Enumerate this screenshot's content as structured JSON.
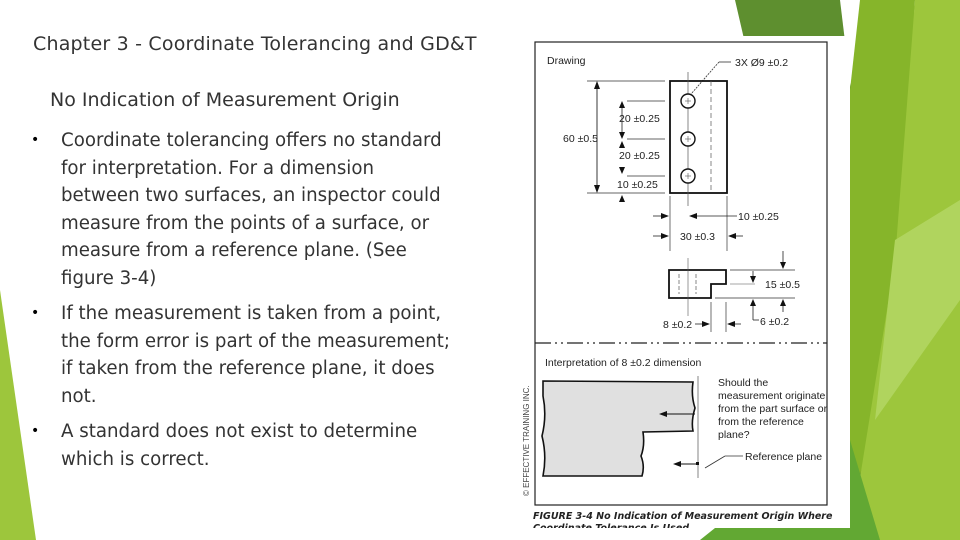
{
  "slide": {
    "title": "Chapter 3 - Coordinate Tolerancing and GD&T",
    "subtitle": "No Indication of Measurement Origin",
    "bullets": [
      "Coordinate tolerancing offers no standard for interpretation.  For a dimension between two surfaces, an inspector could measure from the points of a surface, or measure from a reference plane.  (See figure 3-4)",
      "If the measurement is taken from a point, the form error is part of the measurement; if taken from the reference plane, it does not.",
      "A standard does not exist to determine which is correct."
    ],
    "bullet_icon": "bullet-dot-icon"
  },
  "theme": {
    "green_dark": "#5e8f2f",
    "green_mid": "#86b52a",
    "green_light": "#9dc63c",
    "green_pale": "#b6d86a",
    "text": "#333333"
  },
  "figure": {
    "drawing_label": "Drawing",
    "hole_callout": "3X Ø9 ±0.2",
    "dim_60": "60 ±0.5",
    "dim_20a": "20 ±0.25",
    "dim_20b": "20 ±0.25",
    "dim_10v": "10 ±0.25",
    "dim_10h": "10 ±0.25",
    "dim_30": "30 ±0.3",
    "dim_15": "15 ±0.5",
    "dim_8": "8 ±0.2",
    "dim_6": "6 ±0.2",
    "interpretation_label": "Interpretation of 8 ±0.2 dimension",
    "question": [
      "Should the",
      "measurement originate",
      "from the part surface or",
      "from the reference",
      "plane?"
    ],
    "reference_plane_label": "Reference plane",
    "copyright": "© EFFECTIVE TRAINING INC.",
    "caption_line1": "FIGURE 3-4  No Indication of Measurement Origin Where",
    "caption_line2": "Coordinate Tolerance Is Used"
  }
}
